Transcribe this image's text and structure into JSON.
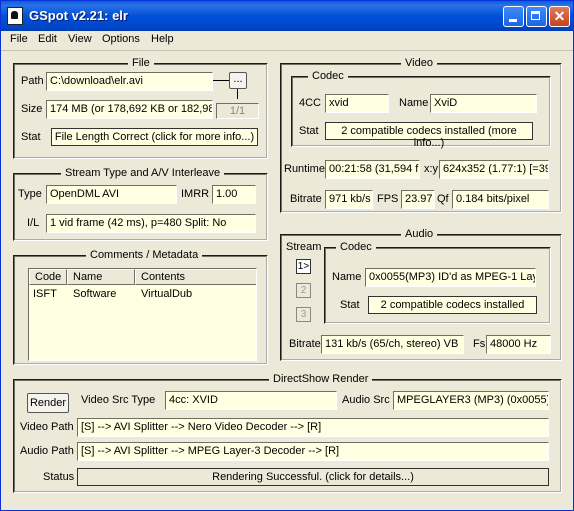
{
  "window": {
    "title": "GSpot v2.21: elr"
  },
  "menu": [
    "File",
    "Edit",
    "View",
    "Options",
    "Help"
  ],
  "file_group": {
    "title": "File",
    "path_label": "Path",
    "path_value": "C:\\download\\elr.avi",
    "browse_label": "...",
    "size_label": "Size",
    "size_value": "174 MB (or 178,692 KB or 182,98",
    "page_counter": "1/1",
    "stat_label": "Stat",
    "stat_value": "File Length Correct (click for more info...)"
  },
  "stream_group": {
    "title": "Stream Type and A/V Interleave",
    "type_label": "Type",
    "type_value": "OpenDML AVI",
    "imrr_label": "IMRR",
    "imrr_value": "1.00",
    "il_label": "I/L",
    "il_value": "1 vid frame (42 ms), p=480  Split: No"
  },
  "comments_group": {
    "title": "Comments / Metadata",
    "columns": [
      "Code",
      "Name",
      "Contents"
    ],
    "rows": [
      {
        "code": "ISFT",
        "name": "Software",
        "contents": "VirtualDub"
      }
    ]
  },
  "video_group": {
    "title": "Video",
    "codec_title": "Codec",
    "fourcc_label": "4CC",
    "fourcc_value": "xvid",
    "name_label": "Name",
    "name_value": "XviD",
    "stat_label": "Stat",
    "stat_value": "2 compatible codecs installed (more info...)",
    "runtime_label": "Runtime",
    "runtime_value": "00:21:58 (31,594 fr",
    "xy_label": "x:y",
    "xy_value": "624x352 (1.77:1) [=39",
    "bitrate_label": "Bitrate",
    "bitrate_value": "971 kb/s",
    "fps_label": "FPS",
    "fps_value": "23.97",
    "qf_label": "Qf",
    "qf_value": "0.184 bits/pixel"
  },
  "audio_group": {
    "title": "Audio",
    "stream_label": "Stream",
    "streams": [
      "1>",
      "2",
      "3"
    ],
    "codec_title": "Codec",
    "name_label": "Name",
    "name_value": "0x0055(MP3) ID'd as MPEG-1 Lay",
    "stat_label": "Stat",
    "stat_value": "2 compatible codecs installed",
    "bitrate_label": "Bitrate",
    "bitrate_value": "131 kb/s (65/ch, stereo) VB",
    "fs_label": "Fs",
    "fs_value": "48000 Hz"
  },
  "render_group": {
    "title": "DirectShow Render",
    "render_button": "Render",
    "video_src_type_label": "Video Src Type",
    "video_src_type_value": "4cc: XVID",
    "audio_src_label": "Audio Src",
    "audio_src_value": "MPEGLAYER3 (MP3) (0x0055)",
    "video_path_label": "Video Path",
    "video_path_value": "[S] --> AVI Splitter --> Nero Video Decoder --> [R]",
    "audio_path_label": "Audio Path",
    "audio_path_value": "[S] --> AVI Splitter --> MPEG Layer-3 Decoder --> [R]",
    "status_label": "Status",
    "status_value": "Rendering Successful.  (click for details...)"
  }
}
